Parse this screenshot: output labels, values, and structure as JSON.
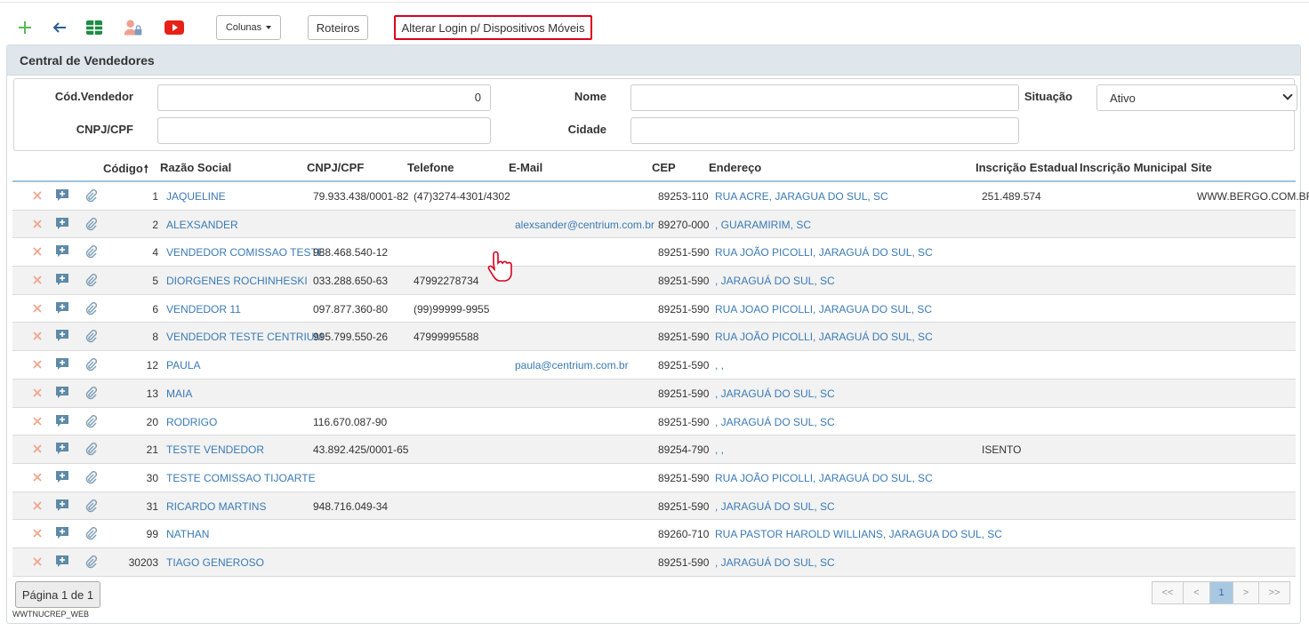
{
  "toolbar": {
    "colunas_label": "Colunas",
    "roteiros_label": "Roteiros",
    "alterar_login_label": "Alterar Login p/ Dispositivos Móveis"
  },
  "panel": {
    "title": "Central de Vendedores"
  },
  "filters": {
    "cod_vendedor_label": "Cód.Vendedor",
    "cod_vendedor_value": "0",
    "nome_label": "Nome",
    "nome_value": "",
    "situacao_label": "Situação",
    "situacao_value": "Ativo",
    "cnpj_label": "CNPJ/CPF",
    "cnpj_value": "",
    "cidade_label": "Cidade",
    "cidade_value": ""
  },
  "grid": {
    "columns": {
      "codigo": "Código",
      "razao": "Razão Social",
      "cnpj": "CNPJ/CPF",
      "telefone": "Telefone",
      "email": "E-Mail",
      "cep": "CEP",
      "endereco": "Endereço",
      "ie": "Inscrição Estadual",
      "im": "Inscrição Municipal",
      "site": "Site"
    },
    "rows": [
      {
        "codigo": "1",
        "razao": "JAQUELINE",
        "cnpj": "79.933.438/0001-82",
        "telefone": "(47)3274-4301/4302",
        "email": "",
        "cep": "89253-110",
        "endereco": "RUA ACRE, JARAGUA DO SUL, SC",
        "ie": "251.489.574",
        "im": "",
        "site": "WWW.BERGO.COM.BR"
      },
      {
        "codigo": "2",
        "razao": "ALEXSANDER",
        "cnpj": "",
        "telefone": "",
        "email": "alexsander@centrium.com.br",
        "cep": "89270-000",
        "endereco": ", GUARAMIRIM, SC",
        "ie": "",
        "im": "",
        "site": ""
      },
      {
        "codigo": "4",
        "razao": "VENDEDOR COMISSAO TESTE",
        "cnpj": "988.468.540-12",
        "telefone": "",
        "email": "",
        "cep": "89251-590",
        "endereco": "RUA JOÃO PICOLLI, JARAGUÁ DO SUL, SC",
        "ie": "",
        "im": "",
        "site": ""
      },
      {
        "codigo": "5",
        "razao": "DIORGENES ROCHINHESKI",
        "cnpj": "033.288.650-63",
        "telefone": "47992278734",
        "email": "",
        "cep": "89251-590",
        "endereco": ", JARAGUÁ DO SUL, SC",
        "ie": "",
        "im": "",
        "site": ""
      },
      {
        "codigo": "6",
        "razao": "VENDEDOR 11",
        "cnpj": "097.877.360-80",
        "telefone": "(99)99999-9955",
        "email": "",
        "cep": "89251-590",
        "endereco": "RUA JOAO PICOLLI, JARAGUA DO SUL, SC",
        "ie": "",
        "im": "",
        "site": ""
      },
      {
        "codigo": "8",
        "razao": "VENDEDOR TESTE CENTRIUM",
        "cnpj": "995.799.550-26",
        "telefone": "47999995588",
        "email": "",
        "cep": "89251-590",
        "endereco": "RUA JOÃO PICOLLI, JARAGUÁ DO SUL, SC",
        "ie": "",
        "im": "",
        "site": ""
      },
      {
        "codigo": "12",
        "razao": "PAULA",
        "cnpj": "",
        "telefone": "",
        "email": "paula@centrium.com.br",
        "cep": "89251-590",
        "endereco": ", ,",
        "ie": "",
        "im": "",
        "site": ""
      },
      {
        "codigo": "13",
        "razao": "MAIA",
        "cnpj": "",
        "telefone": "",
        "email": "",
        "cep": "89251-590",
        "endereco": ", JARAGUÁ DO SUL, SC",
        "ie": "",
        "im": "",
        "site": ""
      },
      {
        "codigo": "20",
        "razao": "RODRIGO",
        "cnpj": "116.670.087-90",
        "telefone": "",
        "email": "",
        "cep": "89251-590",
        "endereco": ", JARAGUÁ DO SUL, SC",
        "ie": "",
        "im": "",
        "site": ""
      },
      {
        "codigo": "21",
        "razao": "TESTE VENDEDOR",
        "cnpj": "43.892.425/0001-65",
        "telefone": "",
        "email": "",
        "cep": "89254-790",
        "endereco": ", ,",
        "ie": "ISENTO",
        "im": "",
        "site": ""
      },
      {
        "codigo": "30",
        "razao": "TESTE COMISSAO TIJOARTE",
        "cnpj": "",
        "telefone": "",
        "email": "",
        "cep": "89251-590",
        "endereco": "RUA JOÃO PICOLLI, JARAGUÁ DO SUL, SC",
        "ie": "",
        "im": "",
        "site": ""
      },
      {
        "codigo": "31",
        "razao": "RICARDO MARTINS",
        "cnpj": "948.716.049-34",
        "telefone": "",
        "email": "",
        "cep": "89251-590",
        "endereco": ", JARAGUÁ DO SUL, SC",
        "ie": "",
        "im": "",
        "site": ""
      },
      {
        "codigo": "99",
        "razao": "NATHAN",
        "cnpj": "",
        "telefone": "",
        "email": "",
        "cep": "89260-710",
        "endereco": "RUA PASTOR HAROLD WILLIANS, JARAGUA DO SUL, SC",
        "ie": "",
        "im": "",
        "site": ""
      },
      {
        "codigo": "30203",
        "razao": "TIAGO GENEROSO",
        "cnpj": "",
        "telefone": "",
        "email": "",
        "cep": "89251-590",
        "endereco": ", JARAGUÁ DO SUL, SC",
        "ie": "",
        "im": "",
        "site": ""
      }
    ]
  },
  "pagination": {
    "info": "Página 1 de 1",
    "first": "<<",
    "prev": "<",
    "current": "1",
    "next": ">",
    "last": ">>"
  },
  "footer_code": "WWTNUCREP_WEB",
  "colors": {
    "link": "#3a7ab5",
    "highlight_border": "#d9001b",
    "panel_heading": "#dfe6ec",
    "row_alt": "#f2f2f2"
  }
}
